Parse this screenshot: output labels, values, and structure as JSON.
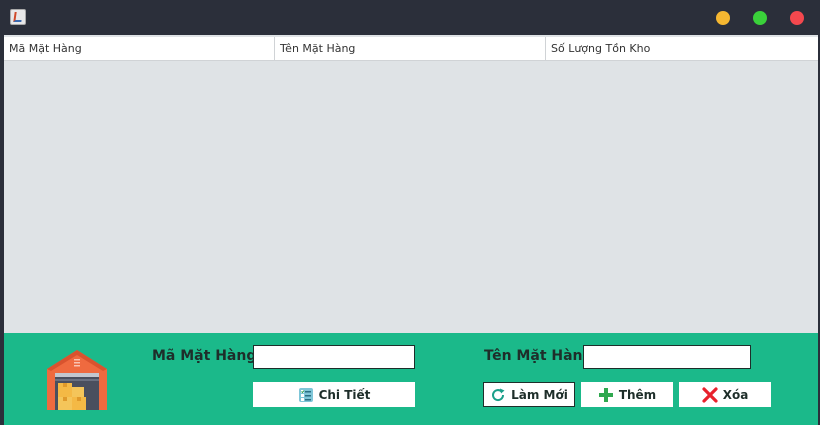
{
  "window": {
    "app_icon": "java-coffee-icon",
    "controls": [
      "minimize",
      "maximize",
      "close"
    ]
  },
  "table": {
    "columns": [
      "Mã Mặt Hàng",
      "Tên Mặt Hàng",
      "Số Lượng Tồn Kho"
    ],
    "rows": []
  },
  "form": {
    "icon": "warehouse-icon",
    "ma_label": "Mã Mặt Hàng",
    "ma_value": "",
    "ten_label": "Tên Mặt Hàng",
    "ten_value": "",
    "buttons": {
      "detail": "Chi Tiết",
      "refresh": "Làm Mới",
      "add": "Thêm",
      "delete": "Xóa"
    }
  },
  "colors": {
    "titlebar": "#2b2f3a",
    "panel": "#1bb98a",
    "table_bg": "#dfe3e6",
    "minimize": "#f5b731",
    "maximize": "#3ad13a",
    "close": "#f4484e"
  }
}
